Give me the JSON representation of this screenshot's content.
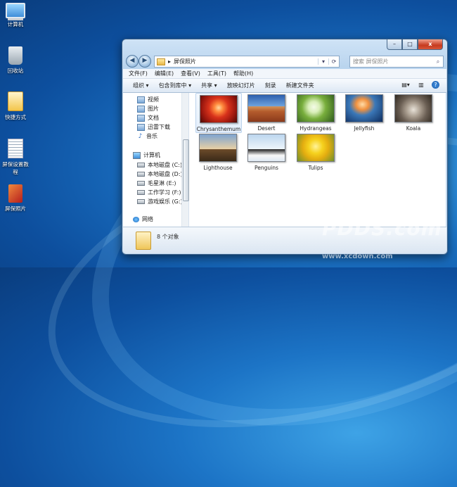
{
  "desktop": {
    "icons": [
      {
        "label": "计算机",
        "icon": "computer-icon"
      },
      {
        "label": "回收站",
        "icon": "recycle-bin-icon"
      },
      {
        "label": "快捷方式",
        "icon": "shortcut-icon"
      },
      {
        "label": "屏保设置教程",
        "icon": "document-icon"
      },
      {
        "label": "屏保照片",
        "icon": "app-icon"
      }
    ],
    "watermark": "PDDS.com",
    "watermark_sub": "www.xcdown.com"
  },
  "window": {
    "caption": {
      "min": "–",
      "max": "□",
      "close": "x"
    },
    "address": {
      "breadcrumb": "屏保照片",
      "separator": "▸",
      "dropdown": "▾",
      "refresh": "⟳"
    },
    "search": {
      "placeholder": "搜索 屏保照片",
      "icon": "⌕"
    },
    "menu": [
      "文件(F)",
      "编辑(E)",
      "查看(V)",
      "工具(T)",
      "帮助(H)"
    ],
    "toolbar": {
      "items": [
        "组织 ▾",
        "包含到库中 ▾",
        "共享 ▾",
        "放映幻灯片",
        "刻录",
        "新建文件夹"
      ],
      "view_icon": "▤▾",
      "pane_icon": "▥",
      "help_icon": "?"
    },
    "nav": {
      "libraries": [
        "视频",
        "图片",
        "文档",
        "迅雷下载",
        "音乐"
      ],
      "computer": "计算机",
      "drives": [
        "本地磁盘 (C:)",
        "本地磁盘 (D:)",
        "毛星淋 (E:)",
        "工作学习 (F:)",
        "游戏娱乐 (G:)"
      ],
      "network": "网络",
      "music_glyph": "♪"
    },
    "files": [
      {
        "name": "Chrysanthemum"
      },
      {
        "name": "Desert"
      },
      {
        "name": "Hydrangeas"
      },
      {
        "name": "Jellyfish"
      },
      {
        "name": "Koala"
      },
      {
        "name": "Lighthouse"
      },
      {
        "name": "Penguins"
      },
      {
        "name": "Tulips"
      }
    ],
    "status": {
      "count": "8 个对象"
    }
  }
}
